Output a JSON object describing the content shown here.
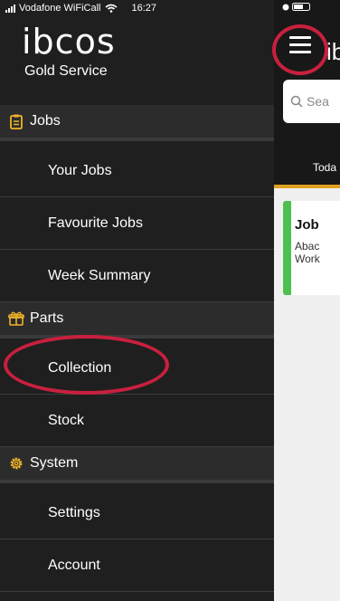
{
  "status_bar": {
    "carrier": "Vodafone WiFiCall",
    "time": "16:27"
  },
  "drawer": {
    "logo_text": "ibcos",
    "subtitle": "Gold Service",
    "sections": [
      {
        "label": "Jobs",
        "icon": "clipboard-icon",
        "items": [
          "Your Jobs",
          "Favourite Jobs",
          "Week Summary"
        ]
      },
      {
        "label": "Parts",
        "icon": "gift-box-icon",
        "items": [
          "Collection",
          "Stock"
        ]
      },
      {
        "label": "System",
        "icon": "gear-icon",
        "items": [
          "Settings",
          "Account"
        ]
      }
    ]
  },
  "background_page": {
    "logo_partial": "ib",
    "search_placeholder": "Sea",
    "tab_partial": "Toda",
    "card": {
      "title_partial": "Job",
      "line1_partial": "Abac",
      "line2_partial": "Work"
    }
  },
  "colors": {
    "drawer_bg": "#1f1f1f",
    "section_bg": "#2c2c2c",
    "annotation_red": "#c8203e",
    "job_status_green": "#4cc14f",
    "tab_accent": "#e0a020"
  }
}
